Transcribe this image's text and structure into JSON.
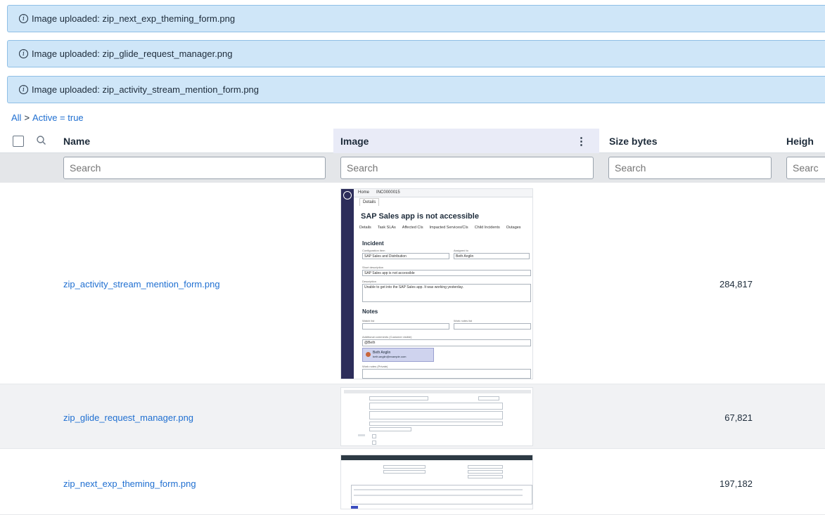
{
  "banners": [
    {
      "icon": "info-icon",
      "icon_glyph": "i",
      "text": "Image uploaded: zip_next_exp_theming_form.png"
    },
    {
      "icon": "info-icon",
      "icon_glyph": "i",
      "text": "Image uploaded: zip_glide_request_manager.png"
    },
    {
      "icon": "info-icon",
      "icon_glyph": "i",
      "text": "Image uploaded: zip_activity_stream_mention_form.png"
    }
  ],
  "breadcrumb": {
    "root": "All",
    "separator": ">",
    "filter": "Active = true"
  },
  "columns": {
    "name": "Name",
    "image": "Image",
    "size": "Size bytes",
    "height": "Heigh"
  },
  "search": {
    "placeholder": "Search",
    "height_placeholder": "Searc"
  },
  "rows": [
    {
      "name": "zip_activity_stream_mention_form.png",
      "size": "284,817"
    },
    {
      "name": "zip_glide_request_manager.png",
      "size": "67,821"
    },
    {
      "name": "zip_next_exp_theming_form.png",
      "size": "197,182"
    }
  ],
  "thumb1": {
    "home_tab": "Home",
    "record_tab": "INC0000015",
    "details_tab": "Details",
    "title": "SAP Sales app is not accessible",
    "tabs": [
      "Details",
      "Task SLAs",
      "Affected CIs",
      "Impacted Services/CIs",
      "Child Incidents",
      "Outages"
    ],
    "section_incident": "Incident",
    "config_item_label": "Configuration item",
    "config_item_value": "SAP Sales and Distribution",
    "assigned_to_label": "Assigned to",
    "assigned_to_value": "Beth Anglin",
    "short_desc_label": "Short description",
    "short_desc_value": "SAP Sales app is not accessible",
    "description_label": "Description",
    "description_value": "Unable to get into the SAP Sales app. It was working yesterday.",
    "section_notes": "Notes",
    "watch_list_label": "Watch list",
    "work_notes_list_label": "Work notes list",
    "additional_comments_label": "Additional comments (Customer visible)",
    "comment_value": "@Beth",
    "mention_name": "Beth Anglin",
    "mention_email": "beth.anglin@example.com",
    "work_notes_label": "Work notes (Private)"
  },
  "colors": {
    "link": "#1f6fd1",
    "banner_bg": "#cfe6f8",
    "banner_border": "#8fbfe6",
    "image_col_bg": "#e9ebf7",
    "search_row_bg": "#e4e6e9"
  }
}
